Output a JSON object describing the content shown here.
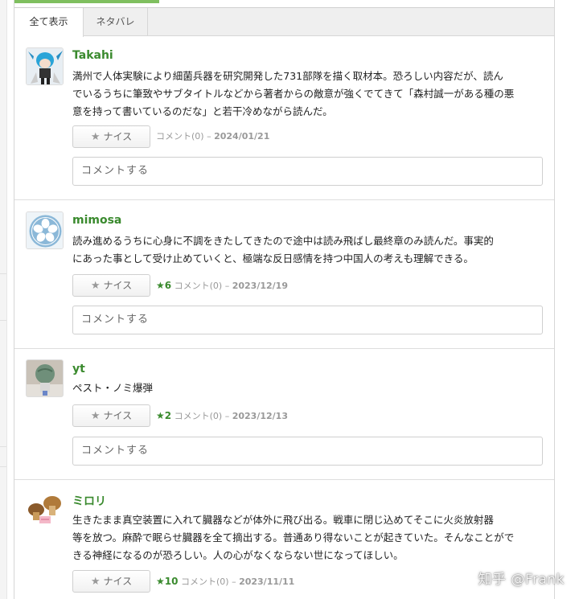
{
  "tabs": [
    {
      "label": "全て表示",
      "active": true
    },
    {
      "label": "ネタバレ",
      "active": false
    }
  ],
  "accent_color": "#7fbf5f",
  "username_color": "#3a8a2e",
  "reviews": [
    {
      "user": "Takahi",
      "avatar_icon": "figure-avatar-icon",
      "lines": [
        "満州で人体実験により細菌兵器を研究開発した731部隊を描く取材本。恐ろしい内容だが、読ん",
        "でいるうちに筆致やサブタイトルなどから著者からの敵意が強くでてきて「森村誠一がある種の悪",
        "意を持って書いているのだな」と若干冷めながら読んだ。"
      ],
      "nice_label": "ナイス",
      "likes": "",
      "comments": "コメント(0)",
      "date": "2024/01/21",
      "comment_placeholder": "コメントする"
    },
    {
      "user": "mimosa",
      "avatar_icon": "flower-avatar-icon",
      "lines": [
        "読み進めるうちに心身に不調をきたしてきたので途中は読み飛ばし最終章のみ読んだ。事実的",
        "にあった事として受け止めていくと、極端な反日感情を持つ中国人の考えも理解できる。"
      ],
      "nice_label": "ナイス",
      "likes": "6",
      "comments": "コメント(0)",
      "date": "2023/12/19",
      "comment_placeholder": "コメントする"
    },
    {
      "user": "yt",
      "avatar_icon": "globe-figure-avatar-icon",
      "lines": [
        "ペスト・ノミ爆弾"
      ],
      "nice_label": "ナイス",
      "likes": "2",
      "comments": "コメント(0)",
      "date": "2023/12/13",
      "comment_placeholder": "コメントする"
    },
    {
      "user": "ミロリ",
      "avatar_icon": "mushroom-avatar-icon",
      "lines": [
        "生きたまま真空装置に入れて臓器などが体外に飛び出る。戦車に閉じ込めてそこに火炎放射器",
        "等を放つ。麻酔で眠らせ臓器を全て摘出する。普通あり得ないことが起きていた。そんなことがで",
        "きる神経になるのが恐ろしい。人の心がなくならない世になってほしい。"
      ],
      "nice_label": "ナイス",
      "likes": "10",
      "comments": "コメント(0)",
      "date": "2023/11/11",
      "comment_placeholder": ""
    }
  ],
  "watermark": "知乎 @Frank"
}
